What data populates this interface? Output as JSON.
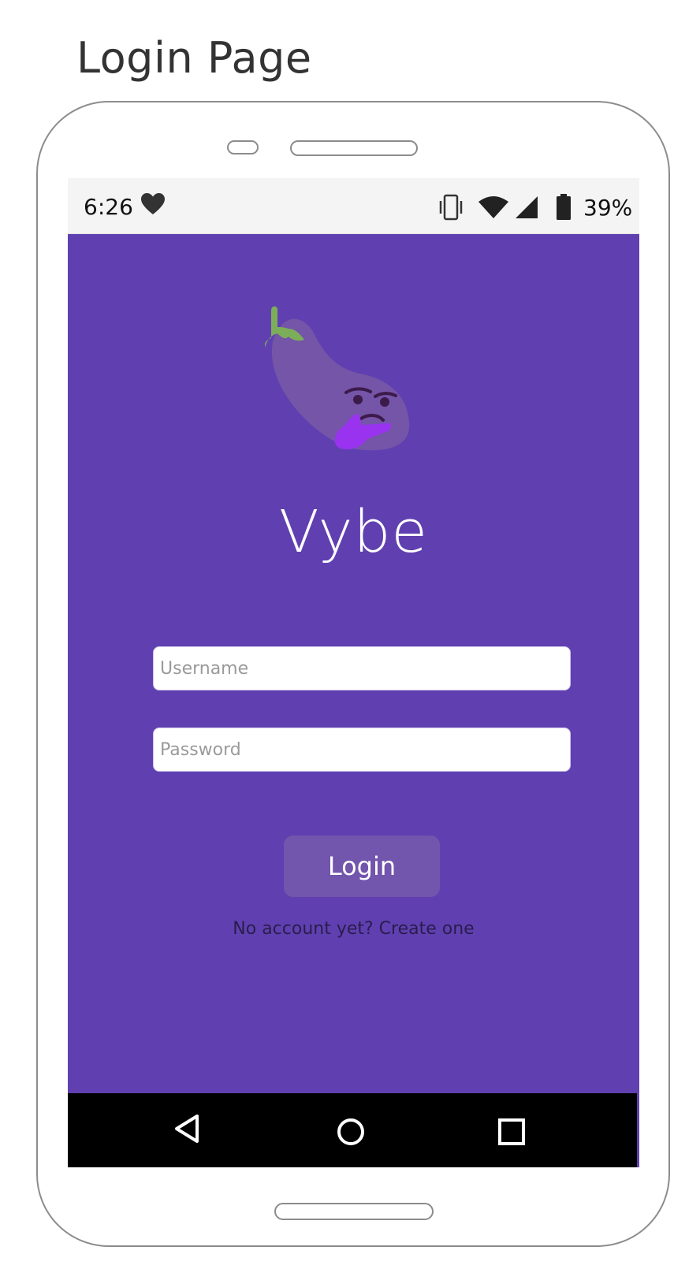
{
  "page_title": "Login Page",
  "status_bar": {
    "time": "6:26",
    "battery_percent": "39%",
    "icons": [
      "heart-icon",
      "vibrate-icon",
      "wifi-icon",
      "cell-signal-icon",
      "battery-icon"
    ]
  },
  "app": {
    "name": "Vybe",
    "logo": "eggplant-thinking-icon"
  },
  "form": {
    "username_placeholder": "Username",
    "password_placeholder": "Password",
    "login_label": "Login",
    "signup_text": "No account yet? Create one"
  },
  "nav_bar": {
    "buttons": [
      "back-icon",
      "home-icon",
      "recents-icon"
    ]
  },
  "colors": {
    "screen_background": "#6040b0",
    "login_button": "#7255ac",
    "status_bar": "#f4f4f4",
    "nav_bar": "#000000",
    "eggplant_body": "#7455a8",
    "eggplant_stem": "#7cae5a",
    "hand": "#9a33f0"
  }
}
